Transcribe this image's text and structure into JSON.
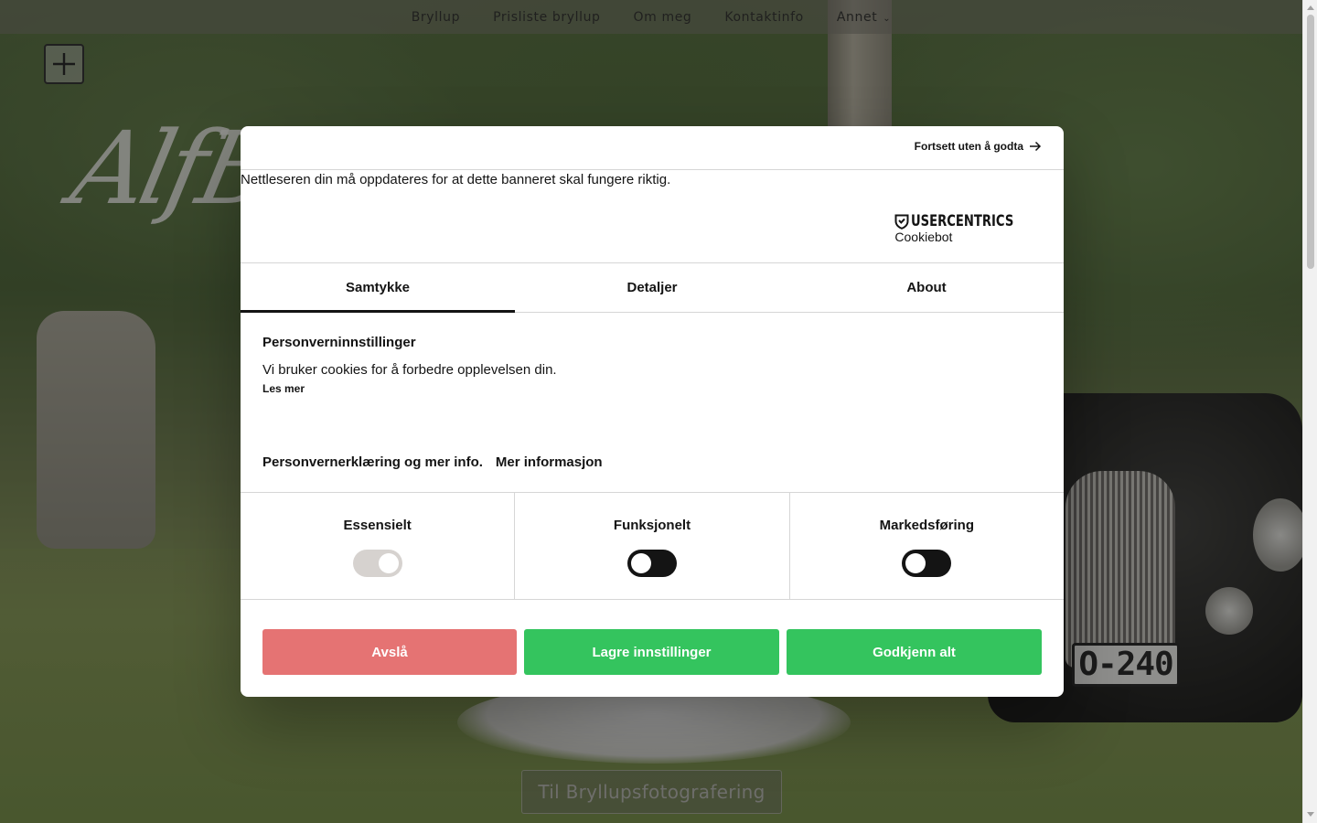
{
  "site": {
    "nav": [
      "Bryllup",
      "Prisliste bryllup",
      "Om meg",
      "Kontaktinfo",
      "Annet"
    ],
    "logo_text": "AlfB",
    "cta_label": "Til Bryllupsfotografering",
    "plate_text": "O-240"
  },
  "dialog": {
    "continue_label": "Fortsett uten å godta",
    "update_notice": "Nettleseren din må oppdateres for at dette banneret skal fungere riktig.",
    "brand_name": "USERCENTRICS",
    "brand_sub": "Cookiebot",
    "tabs": [
      "Samtykke",
      "Detaljer",
      "About"
    ],
    "active_tab": "Samtykke",
    "section_title": "Personverninnstillinger",
    "section_text": "Vi bruker cookies for å forbedre opplevelsen din.",
    "read_more": "Les mer",
    "privacy_link": "Personvernerklæring og mer info.",
    "more_info_link": "Mer informasjon",
    "categories": [
      {
        "label": "Essensielt",
        "state": "on-disabled"
      },
      {
        "label": "Funksjonelt",
        "state": "off"
      },
      {
        "label": "Markedsføring",
        "state": "off"
      }
    ],
    "buttons": {
      "deny": "Avslå",
      "save": "Lagre innstillinger",
      "accept": "Godkjenn alt"
    },
    "colors": {
      "deny": "#e57373",
      "accept": "#34c45e",
      "toggle_off": "#141414"
    }
  }
}
